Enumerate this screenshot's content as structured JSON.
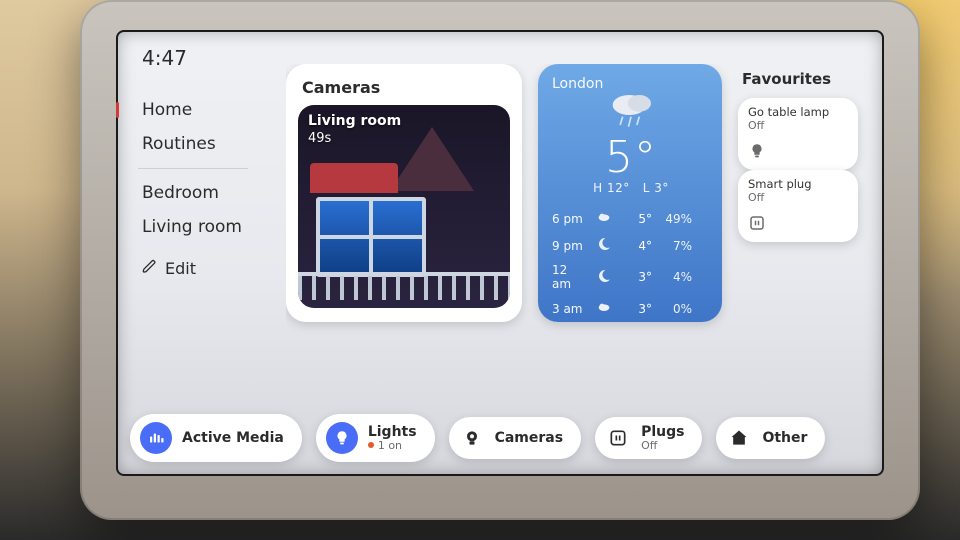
{
  "clock": "4:47",
  "sidebar": {
    "items": [
      {
        "label": "Home",
        "active": true
      },
      {
        "label": "Routines"
      },
      {
        "label": "Bedroom"
      },
      {
        "label": "Living room"
      }
    ],
    "edit_label": "Edit"
  },
  "cameras_card": {
    "title": "Cameras",
    "thumbnail": {
      "room": "Living room",
      "age": "49s"
    }
  },
  "weather": {
    "city": "London",
    "condition_icon": "rain-cloud",
    "temp": "5°",
    "high": "H 12°",
    "low": "L 3°",
    "forecast": [
      {
        "time": "6 pm",
        "icon": "cloud",
        "temp": "5°",
        "humidity": "49%"
      },
      {
        "time": "9 pm",
        "icon": "moon",
        "temp": "4°",
        "humidity": "7%"
      },
      {
        "time": "12 am",
        "icon": "moon",
        "temp": "3°",
        "humidity": "4%"
      },
      {
        "time": "3 am",
        "icon": "cloud",
        "temp": "3°",
        "humidity": "0%"
      }
    ]
  },
  "favourites": {
    "title": "Favourites",
    "tiles": [
      {
        "name": "Go table lamp",
        "state": "Off",
        "icon": "bulb"
      },
      {
        "name": "Smart plug",
        "state": "Off",
        "icon": "plug"
      }
    ]
  },
  "dock": {
    "active_media": {
      "label": "Active Media",
      "icon": "media"
    },
    "lights": {
      "label": "Lights",
      "sub": "1 on",
      "icon": "bulb"
    },
    "cameras": {
      "label": "Cameras",
      "sub": "",
      "icon": "camera"
    },
    "plugs": {
      "label": "Plugs",
      "sub": "Off",
      "icon": "plug"
    },
    "other": {
      "label": "Other",
      "sub": "",
      "icon": "house"
    }
  }
}
